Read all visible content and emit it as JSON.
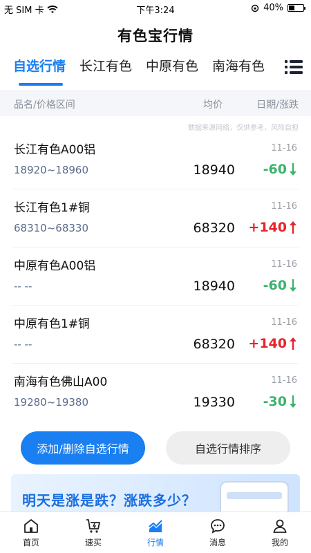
{
  "status_bar": {
    "carrier": "无 SIM 卡",
    "time": "下午3:24",
    "battery": "40%",
    "battery_level": 0.4
  },
  "header": {
    "title": "有色宝行情"
  },
  "tabs": [
    {
      "label": "自选行情"
    },
    {
      "label": "长江有色"
    },
    {
      "label": "中原有色"
    },
    {
      "label": "南海有色"
    }
  ],
  "columns": {
    "name": "品名/价格区间",
    "price": "均价",
    "date": "日期/涨跌"
  },
  "source_note": "数据来源网络，仅供参考，风险自担",
  "rows": [
    {
      "name": "长江有色A00铝",
      "date": "11-16",
      "range": "18920~18960",
      "price": "18940",
      "change": "-60",
      "dir": "down"
    },
    {
      "name": "长江有色1#铜",
      "date": "11-16",
      "range": "68310~68330",
      "price": "68320",
      "change": "+140",
      "dir": "up"
    },
    {
      "name": "中原有色A00铝",
      "date": "11-16",
      "range": "-- --",
      "price": "18940",
      "change": "-60",
      "dir": "down"
    },
    {
      "name": "中原有色1#铜",
      "date": "11-16",
      "range": "-- --",
      "price": "68320",
      "change": "+140",
      "dir": "up"
    },
    {
      "name": "南海有色佛山A00",
      "date": "11-16",
      "range": "19280~19380",
      "price": "19330",
      "change": "-30",
      "dir": "down"
    }
  ],
  "buttons": {
    "add_remove": "添加/删除自选行情",
    "sort": "自选行情排序"
  },
  "banner": {
    "text": "明天是涨是跌？涨跌多少？"
  },
  "tabbar": [
    {
      "label": "首页",
      "icon": "home-icon"
    },
    {
      "label": "速买",
      "icon": "cart-icon"
    },
    {
      "label": "行情",
      "icon": "chart-icon"
    },
    {
      "label": "消息",
      "icon": "message-icon"
    },
    {
      "label": "我的",
      "icon": "user-icon"
    }
  ],
  "colors": {
    "accent": "#1a7ff0",
    "up": "#e8232a",
    "down": "#3ab36b"
  }
}
